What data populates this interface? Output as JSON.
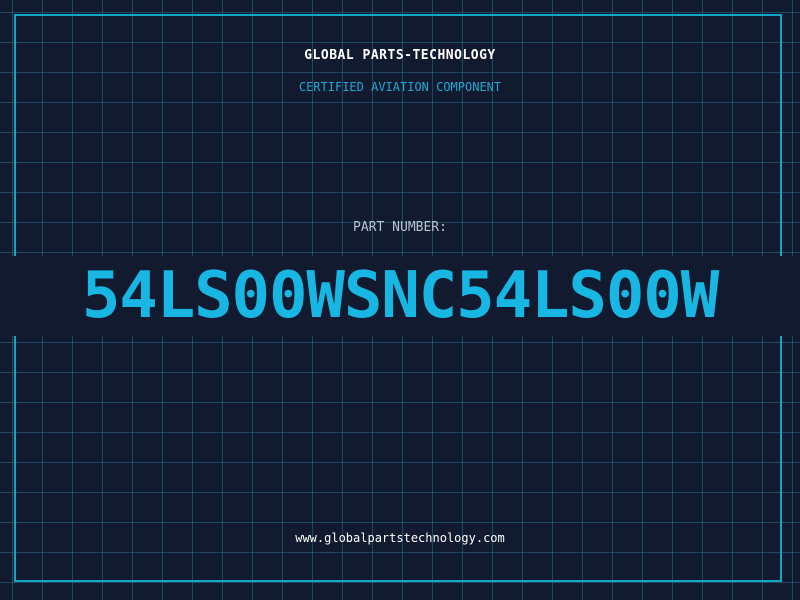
{
  "header": {
    "company": "GLOBAL PARTS-TECHNOLOGY",
    "subtitle": "CERTIFIED AVIATION COMPONENT"
  },
  "part": {
    "label": "PART NUMBER:",
    "number": "54LS00WSNC54LS00W"
  },
  "footer": {
    "website": "www.globalpartstechnology.com"
  },
  "colors": {
    "background": "#111a2e",
    "grid": "#286e8c",
    "frame": "#14a4c4",
    "accent": "#18b6e2",
    "subtitle": "#20a8d4",
    "label": "#b8c3d2",
    "text": "#ffffff"
  }
}
